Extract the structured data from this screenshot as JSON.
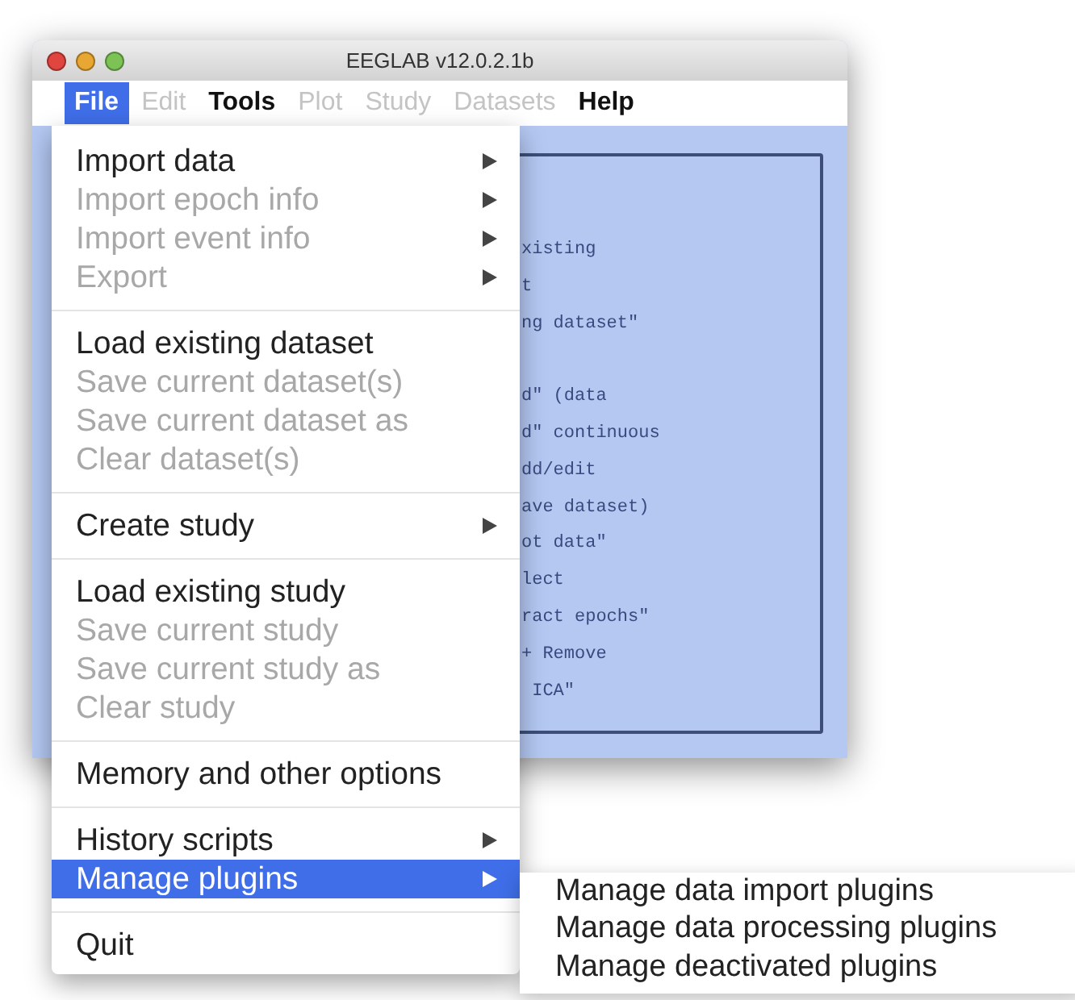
{
  "window": {
    "title": "EEGLAB v12.0.2.1b"
  },
  "menubar": [
    {
      "label": "File",
      "selected": true,
      "disabled": false
    },
    {
      "label": "Edit",
      "selected": false,
      "disabled": true
    },
    {
      "label": "Tools",
      "selected": false,
      "disabled": false
    },
    {
      "label": "Plot",
      "selected": false,
      "disabled": true
    },
    {
      "label": "Study",
      "selected": false,
      "disabled": true
    },
    {
      "label": "Datasets",
      "selected": false,
      "disabled": true
    },
    {
      "label": "Help",
      "selected": false,
      "disabled": false
    }
  ],
  "content_lines": [
    {
      "text": "xisting",
      "gap_before": false
    },
    {
      "text": "t",
      "gap_before": false
    },
    {
      "text": "ng dataset\"",
      "gap_before": false
    },
    {
      "text": "d\" (data",
      "gap_before": true
    },
    {
      "text": "d\" continuous",
      "gap_before": false
    },
    {
      "text": "dd/edit",
      "gap_before": false
    },
    {
      "text": "ave dataset)",
      "gap_before": false
    },
    {
      "text": "ot data\"",
      "gap_before": false
    },
    {
      "text": "lect",
      "gap_before": false
    },
    {
      "text": "ract epochs\"",
      "gap_before": false
    },
    {
      "text": "+ Remove",
      "gap_before": false
    },
    {
      "text": " ICA\"",
      "gap_before": false
    }
  ],
  "file_menu": [
    [
      {
        "label": "Import data",
        "disabled": false,
        "submenu": true,
        "selected": false
      },
      {
        "label": "Import epoch info",
        "disabled": true,
        "submenu": true,
        "selected": false
      },
      {
        "label": "Import event info",
        "disabled": true,
        "submenu": true,
        "selected": false
      },
      {
        "label": "Export",
        "disabled": true,
        "submenu": true,
        "selected": false
      }
    ],
    [
      {
        "label": "Load existing dataset",
        "disabled": false,
        "submenu": false,
        "selected": false
      },
      {
        "label": "Save current dataset(s)",
        "disabled": true,
        "submenu": false,
        "selected": false
      },
      {
        "label": "Save current dataset as",
        "disabled": true,
        "submenu": false,
        "selected": false
      },
      {
        "label": "Clear dataset(s)",
        "disabled": true,
        "submenu": false,
        "selected": false
      }
    ],
    [
      {
        "label": "Create study",
        "disabled": false,
        "submenu": true,
        "selected": false
      }
    ],
    [
      {
        "label": "Load existing study",
        "disabled": false,
        "submenu": false,
        "selected": false
      },
      {
        "label": "Save current study",
        "disabled": true,
        "submenu": false,
        "selected": false
      },
      {
        "label": "Save current study as",
        "disabled": true,
        "submenu": false,
        "selected": false
      },
      {
        "label": "Clear study",
        "disabled": true,
        "submenu": false,
        "selected": false
      }
    ],
    [
      {
        "label": "Memory and other options",
        "disabled": false,
        "submenu": false,
        "selected": false
      }
    ],
    [
      {
        "label": "History scripts",
        "disabled": false,
        "submenu": true,
        "selected": false
      },
      {
        "label": "Manage plugins",
        "disabled": false,
        "submenu": true,
        "selected": true
      }
    ],
    [
      {
        "label": "Quit",
        "disabled": false,
        "submenu": false,
        "selected": false
      }
    ]
  ],
  "submenu": [
    "Manage data import plugins",
    "Manage data processing plugins",
    "Manage deactivated plugins"
  ]
}
